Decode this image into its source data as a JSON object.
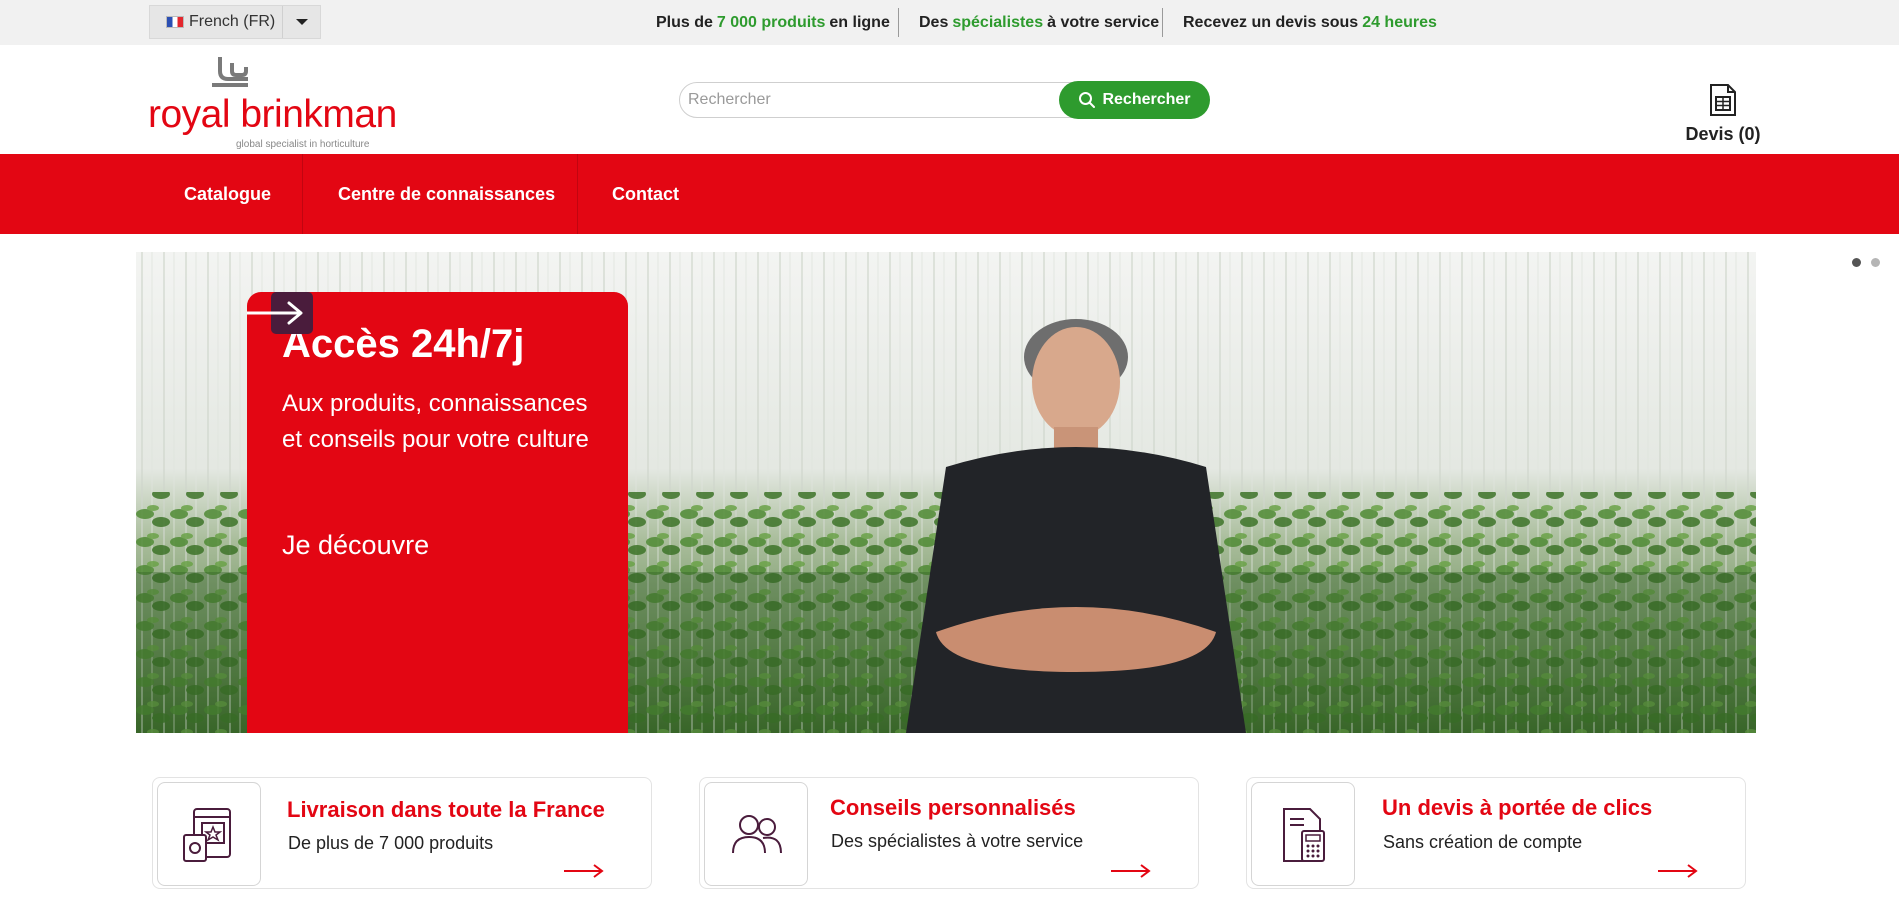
{
  "topbar": {
    "language": "French (FR)",
    "usps": [
      {
        "pre": "Plus de",
        "hl": "7 000 produits",
        "post": "en ligne"
      },
      {
        "pre": "Des",
        "hl": "spécialistes",
        "post": "à votre service"
      },
      {
        "pre": "Recevez un devis sous",
        "hl": "24 heures",
        "post": ""
      }
    ]
  },
  "header": {
    "logo_text": "royal brinkman",
    "logo_tagline": "global specialist in horticulture",
    "search_placeholder": "Rechercher",
    "search_button": "Rechercher",
    "quote_label": "Devis (0)"
  },
  "nav": {
    "items": [
      "Catalogue",
      "Centre de connaissances",
      "Contact"
    ]
  },
  "hero": {
    "title": "Accès 24h/7j",
    "subtitle": "Aux produits, connaissances et conseils pour votre culture",
    "cta": "Je découvre"
  },
  "features": [
    {
      "title": "Livraison dans toute la France",
      "text": "De plus de 7 000 produits",
      "icon": "catalog-icon"
    },
    {
      "title": "Conseils personnalisés",
      "text": "Des spécialistes à votre service",
      "icon": "people-icon"
    },
    {
      "title": "Un devis à portée de clics",
      "text": "Sans création de compte",
      "icon": "quote-calculator-icon"
    }
  ],
  "colors": {
    "brand_red": "#e30613",
    "accent_green": "#2e9b2e",
    "dark_purple": "#4a1c3c"
  }
}
